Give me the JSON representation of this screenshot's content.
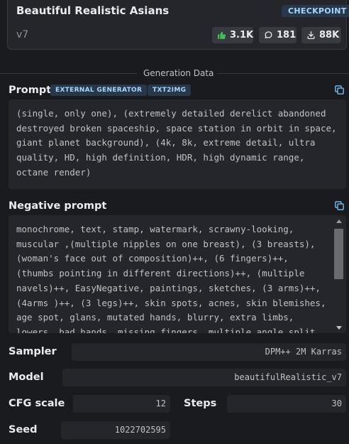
{
  "model": {
    "title": "Beautiful Realistic Asians",
    "badge": "CHECKPOINT",
    "version": "v7",
    "stats": {
      "likes": "3.1K",
      "comments": "181",
      "downloads": "88K"
    }
  },
  "generation": {
    "divider_label": "Generation Data",
    "prompt_label": "Prompt",
    "tags": [
      "EXTERNAL GENERATOR",
      "TXT2IMG"
    ],
    "prompt_text": "(single, only one), (extremely detailed derelict abandoned destroyed broken spaceship, space station in orbit in space, giant planet background), (4k, 8k, extreme detail, ultra quality, HD, high definition, HDR, high dynamic range, octane render)",
    "negative_label": "Negative prompt",
    "negative_text": "monochrome, text, stamp, watermark, scrawny-looking, muscular ,(multiple nipples on one breast), (3 breasts), (woman's face out of composition)++, (6 fingers)++, (thumbs pointing in different directions)++, (multiple navels)++, EasyNegative, paintings, sketches, (3 arms)++, (4arms )++, (3 legs)++, skin spots, acnes, skin blemishes, age spot, glans, mutated hands, blurry, extra limbs, lowers, bad hands, missing fingers, multiple angle split"
  },
  "params": {
    "sampler_label": "Sampler",
    "sampler": "DPM++ 2M Karras",
    "model_label": "Model",
    "model": "beautifulRealistic_v7",
    "cfg_label": "CFG scale",
    "cfg": "12",
    "steps_label": "Steps",
    "steps": "30",
    "seed_label": "Seed",
    "seed": "1022702595"
  },
  "icons": {
    "likes": "thumbs-up-icon",
    "comments": "chat-bubble-icon",
    "downloads": "download-icon",
    "copy": "copy-icon"
  },
  "colors": {
    "background": "#1a1b1e",
    "panel": "#25262b",
    "badge_bg": "#28374a",
    "badge_text": "#a5d8ff",
    "like_green": "#40c057",
    "copy_blue": "#74c0fc"
  }
}
